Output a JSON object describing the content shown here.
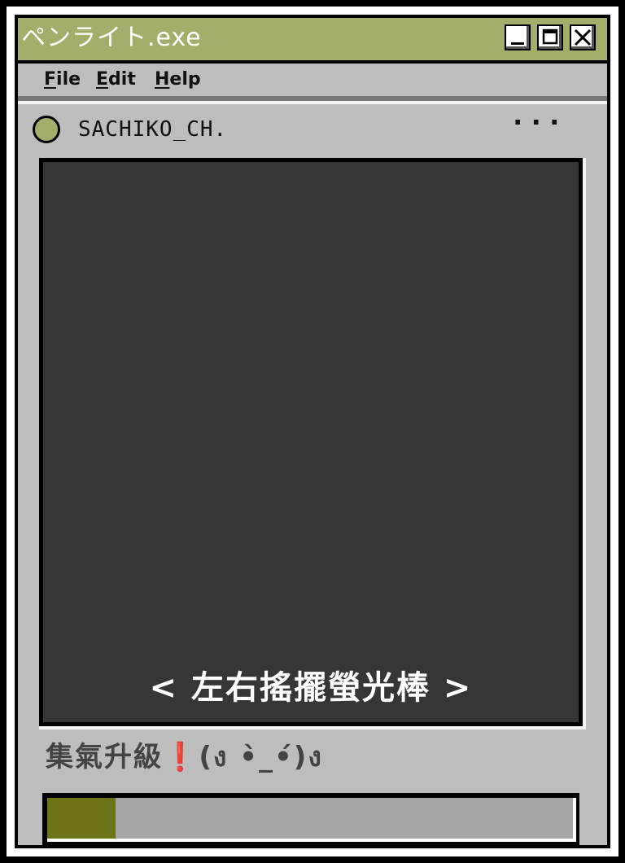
{
  "window": {
    "title": "ペンライト.exe",
    "accent_color": "#a2ae69"
  },
  "window_controls": {
    "minimize_icon": "minimize-icon",
    "maximize_icon": "maximize-icon",
    "close_icon": "close-icon"
  },
  "menu": {
    "items": [
      {
        "mnemonic": "F",
        "rest": "ile"
      },
      {
        "mnemonic": "E",
        "rest": "dit"
      },
      {
        "mnemonic": "H",
        "rest": "elp"
      }
    ]
  },
  "header": {
    "status_color": "#a2ae69",
    "username": "SACHIKO_CH.",
    "more_label": "···"
  },
  "panel": {
    "hint": "< 左右搖擺螢光棒 >"
  },
  "cheer": {
    "label": "集氣升級❗(ง •̀_•́)ง"
  },
  "progress": {
    "fraction": 0.13,
    "fill_color": "#6d7418"
  }
}
